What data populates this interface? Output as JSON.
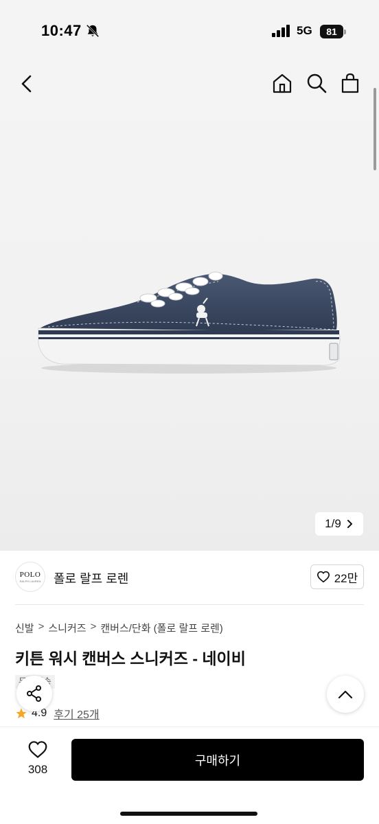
{
  "status_bar": {
    "time": "10:47",
    "network": "5G",
    "battery": "81",
    "icons": [
      "bell-slash-icon",
      "signal-icon",
      "battery-icon"
    ]
  },
  "toolbar": {
    "icons": [
      "back-icon",
      "home-icon",
      "search-icon",
      "cart-icon"
    ]
  },
  "gallery": {
    "counter": "1/9",
    "image_semantic": "navy canvas sneaker with white sole and laces"
  },
  "brand": {
    "logo_text": "POLO",
    "logo_subtext": "RALPH LAUREN",
    "name": "폴로 랄프 로렌",
    "like_count": "22만"
  },
  "breadcrumb": {
    "items": [
      "신발",
      "스니커즈",
      "캔버스/단화 (폴로 랄프 로렌)"
    ],
    "separator": ">"
  },
  "product": {
    "title": "키튼 워시 캔버스 스니커즈 - 네이비",
    "tag": "무료배송",
    "rating": "4.9",
    "review_label": "후기 25개"
  },
  "bottom_bar": {
    "wish_count": "308",
    "buy_label": "구매하기"
  },
  "colors": {
    "accent_star": "#f5a623",
    "buy_button": "#000000",
    "shoe_upper": "#3b4a63"
  }
}
